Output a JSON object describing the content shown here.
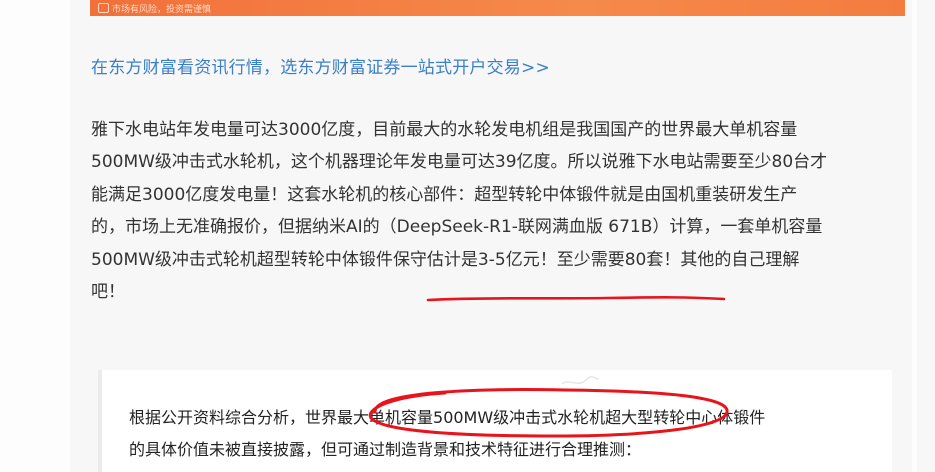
{
  "ad": {
    "disclaimer": "市场有风险，投资需谨慎"
  },
  "promo": {
    "link_text": "在东方财富看资讯行情，选东方财富证券一站式开户交易>>"
  },
  "article": {
    "lines": [
      "雅下水电站年发电量可达3000亿度，目前最大的水轮发电机组是我国国产的世界最大单机容量",
      "500MW级冲击式水轮机，这个机器理论年发电量可达39亿度。所以说雅下水电站需要至少80台才",
      "能满足3000亿度发电量！这套水轮机的核心部件：超型转轮中体锻件就是由国机重装研发生产",
      "的，市场上无准确报价，但据纳米AI的（DeepSeek-R1-联网满血版 671B）计算，一套单机容量"
    ],
    "line5_a": "500MW级冲击式轮机超型转轮中体锻件",
    "line5_b": "保守估计是3-5亿元！至少需要80",
    "line5_c": "套！其他的自己理解",
    "line6": "吧！"
  },
  "quote": {
    "line1_a": "根据公开资料综合分析，世界",
    "line1_b": "最大单机容量500MW级冲击式水轮机超大型",
    "line1_c": "转轮中心体锻件",
    "line2": "的具体价值未被直接披露，但可通过制造背景和技术特征进行合理推测："
  },
  "colors": {
    "link": "#3a7fc8",
    "annotation": "#e8141c",
    "ad_orange": "#f47c3f"
  }
}
